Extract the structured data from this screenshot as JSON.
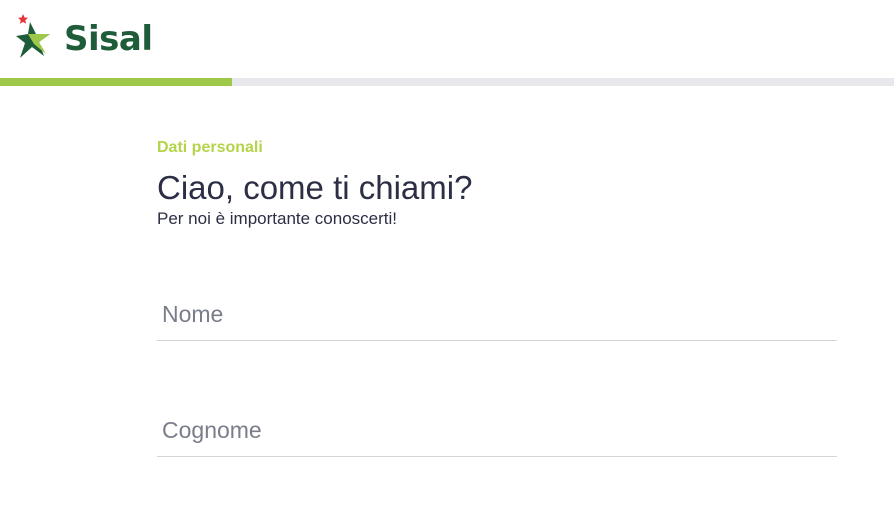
{
  "header": {
    "logo_text": "Sisal",
    "logo_icon": "sisal-star-icon",
    "colors": {
      "brand_green": "#1f5d3a",
      "star_light_green": "#9ec84a",
      "star_red": "#e6343a"
    }
  },
  "progress": {
    "fraction": 0.26,
    "fill_color": "#9ec84a",
    "track_color": "#e8e8ec"
  },
  "form": {
    "section_label": "Dati personali",
    "title": "Ciao, come ti chiami?",
    "subtitle": "Per noi è importante conoscerti!",
    "fields": {
      "first_name": {
        "value": "",
        "placeholder": "Nome"
      },
      "last_name": {
        "value": "",
        "placeholder": "Cognome"
      }
    },
    "accent_color": "#b4d44a",
    "text_color": "#2b2e45"
  }
}
